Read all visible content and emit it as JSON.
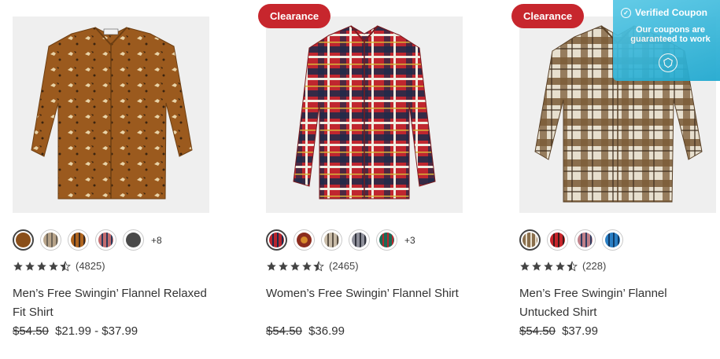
{
  "coupon": {
    "title": "Verified Coupon",
    "line1": "Our coupons are",
    "line2": "guaranteed to work",
    "icon": "shield-icon"
  },
  "products": [
    {
      "badge": "",
      "swatches": [
        "#8a4f1a",
        "#b8a48a",
        "#b0651e",
        "#c46b6e",
        "#4a4a4a"
      ],
      "more_colors": "+8",
      "rating_count": "(4825)",
      "rating_value": 4.5,
      "name": "Men’s Free Swingin’ Flannel Relaxed Fit Shirt",
      "was_price": "$54.50",
      "price": "$21.99 - $37.99"
    },
    {
      "badge": "Clearance",
      "swatches": [
        "#b8262e",
        "#8b2c1e",
        "#c9bca8",
        "#8e8f9a",
        "#1c6a55"
      ],
      "more_colors": "+3",
      "rating_count": "(2465)",
      "rating_value": 4.5,
      "name": "Women’s Free Swingin’ Flannel Shirt",
      "was_price": "$54.50",
      "price": "$36.99"
    },
    {
      "badge": "Clearance",
      "swatches": [
        "#8a6f4c",
        "#c8252b",
        "#bf7f88",
        "#2a7fc4"
      ],
      "more_colors": "",
      "rating_count": "(228)",
      "rating_value": 4.5,
      "name": "Men’s Free Swingin’ Flannel Untucked Shirt",
      "was_price": "$54.50",
      "price": "$37.99"
    }
  ]
}
